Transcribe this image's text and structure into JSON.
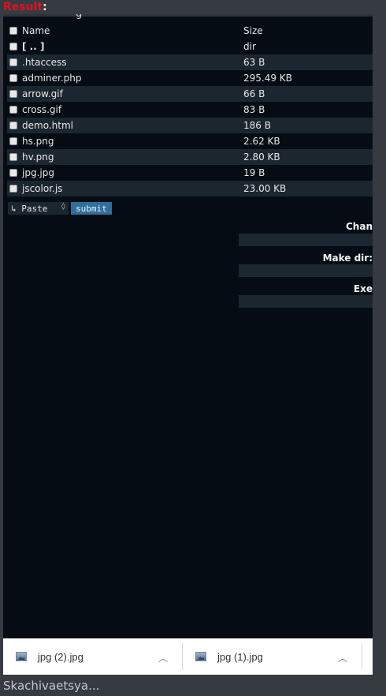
{
  "result_label": {
    "prefix": "Result",
    "suffix": ":"
  },
  "file_table": {
    "headers": {
      "name": "Name",
      "size": "Size"
    },
    "rows": [
      {
        "name": "[ .. ]",
        "size": "dir",
        "is_dir": true
      },
      {
        "name": ".htaccess",
        "size": "63 B"
      },
      {
        "name": "adminer.php",
        "size": "295.49 KB"
      },
      {
        "name": "arrow.gif",
        "size": "66 B"
      },
      {
        "name": "cross.gif",
        "size": "83 B"
      },
      {
        "name": "demo.html",
        "size": "186 B"
      },
      {
        "name": "hs.png",
        "size": "2.62 KB"
      },
      {
        "name": "hv.png",
        "size": "2.80 KB"
      },
      {
        "name": "jpg.jpg",
        "size": "19 B"
      },
      {
        "name": "jscolor.js",
        "size": "23.00 KB"
      }
    ]
  },
  "actions": {
    "paste_select": "↳ Paste",
    "submit": "submit"
  },
  "side_forms": {
    "change_label": "Chan",
    "make_dir_label": "Make dir:",
    "execute_label": "Exe"
  },
  "downloads": [
    {
      "filename": "jpg (2).jpg"
    },
    {
      "filename": "jpg (1).jpg"
    }
  ],
  "status": "Skachivaetsya..."
}
